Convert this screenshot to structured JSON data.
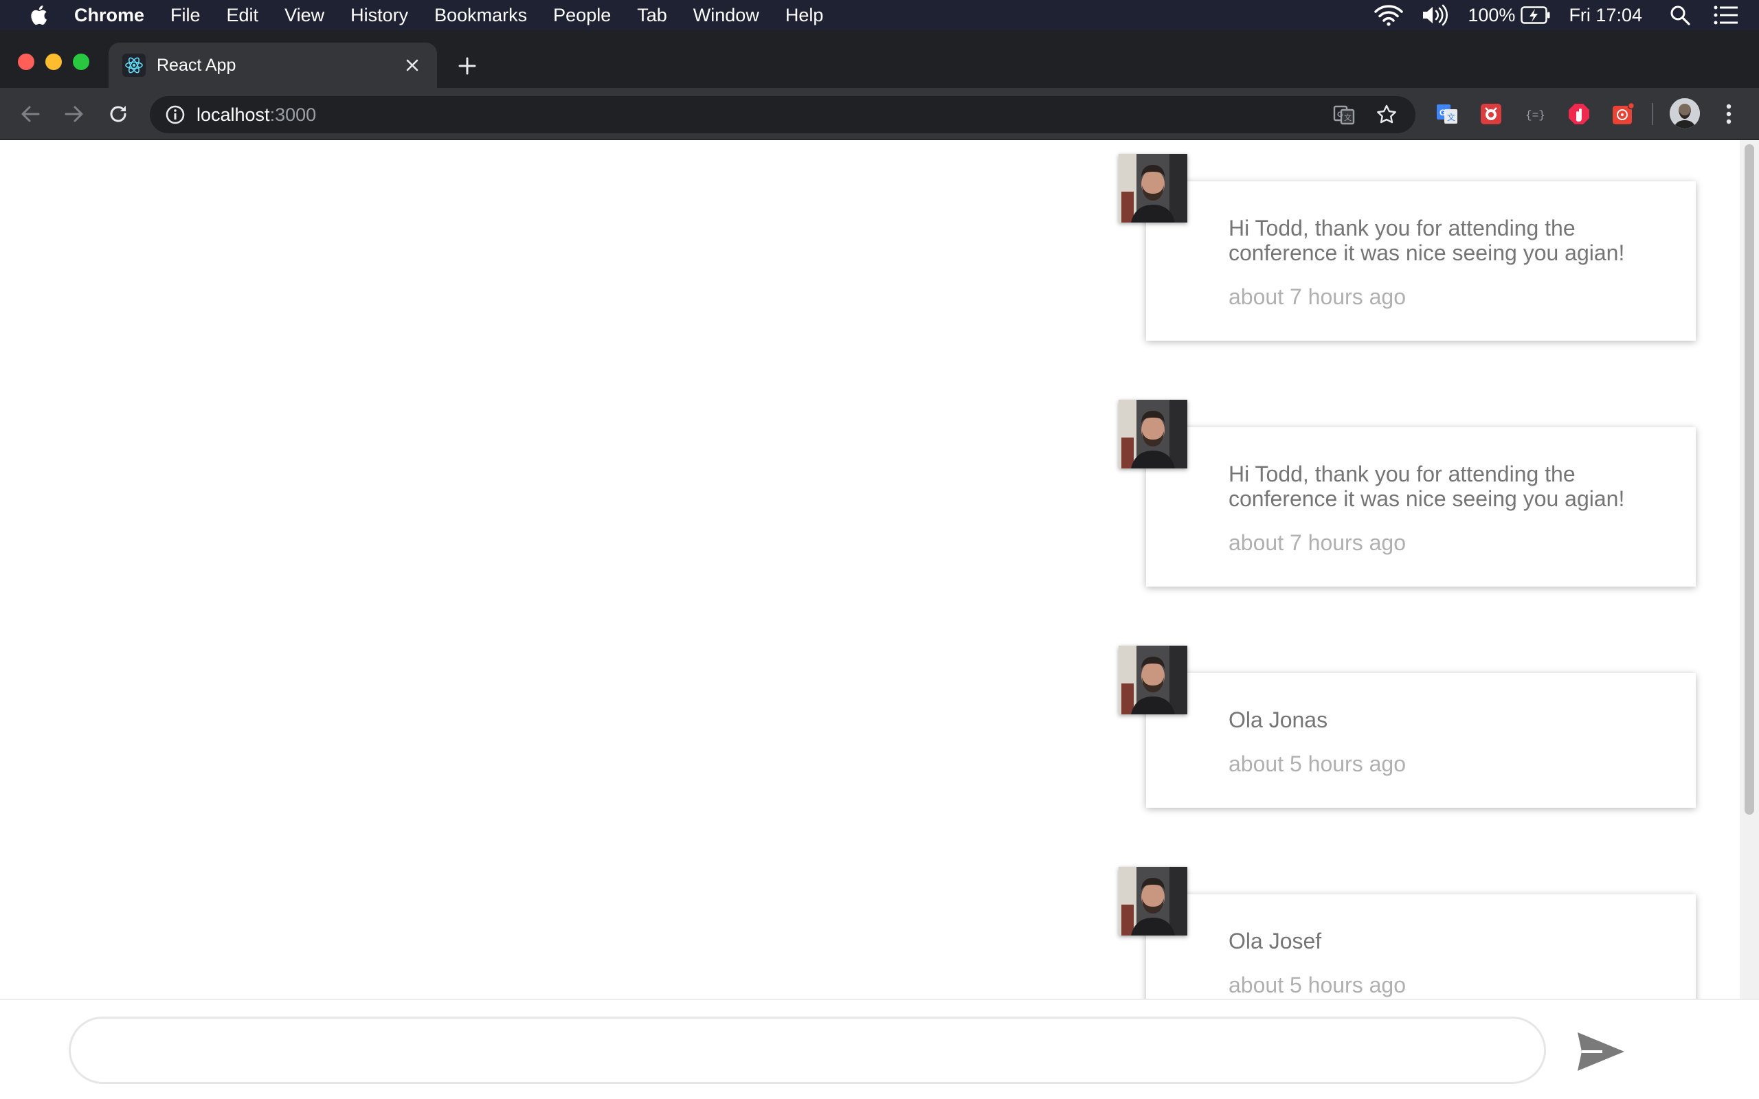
{
  "menubar": {
    "items": [
      "Chrome",
      "File",
      "Edit",
      "View",
      "History",
      "Bookmarks",
      "People",
      "Tab",
      "Window",
      "Help"
    ],
    "battery": "100%",
    "clock": "Fri 17:04"
  },
  "tab": {
    "title": "React App"
  },
  "address": {
    "host": "localhost",
    "port": ":3000"
  },
  "messages": [
    {
      "text": "Hi Todd, thank you for attending the conference it was nice seeing you agian!",
      "time": "about 7 hours ago"
    },
    {
      "text": "Hi Todd, thank you for attending the conference it was nice seeing you agian!",
      "time": "about 7 hours ago"
    },
    {
      "text": "Ola Jonas",
      "time": "about 5 hours ago"
    },
    {
      "text": "Ola Josef",
      "time": "about 5 hours ago"
    }
  ],
  "composer": {
    "value": "",
    "placeholder": ""
  },
  "colors": {
    "menubar": "#1f2233",
    "tabstrip": "#202124",
    "toolbar": "#35363a",
    "message_text": "#757575",
    "timestamp": "#b0b0b0"
  }
}
